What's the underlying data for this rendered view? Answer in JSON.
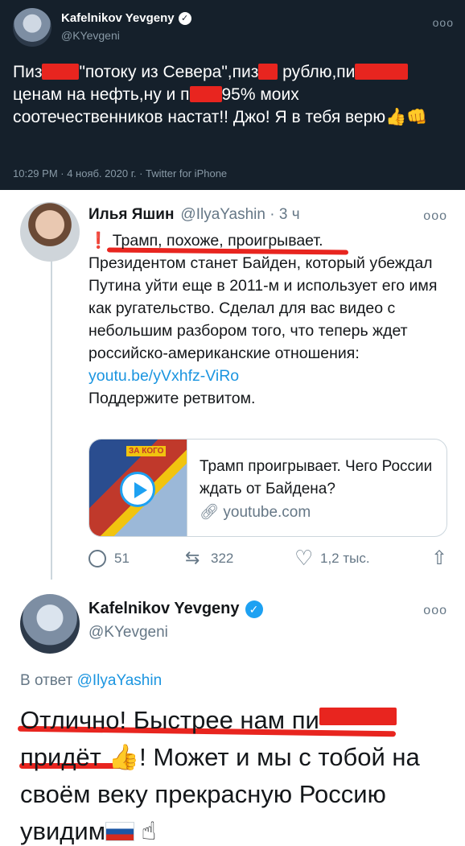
{
  "dark_tweet": {
    "name": "Kafelnikov Yevgeny",
    "handle": "@KYevgeni",
    "text_parts": [
      "Пиз",
      "\"потоку из Севера\",пиз",
      " рублю,пи",
      "ценам на нефть,ну и п",
      "95% моих соотечественников настат!! Джо! Я в тебя верю"
    ],
    "meta": "10:29 PM · 4 нояб. 2020 г. · Twitter for iPhone"
  },
  "yashin_tweet": {
    "name": "Илья Яшин",
    "handle": "@IlyaYashin · 3 ч",
    "alert": "❗",
    "line1": "Трамп, похоже, проигрывает.",
    "body": "Президентом станет Байден, который убеждал Путина уйти еще в 2011-м и использует его имя как ругательство. Сделал для вас видео с небольшим разбором того, что теперь ждет российско-американские отношения:",
    "link": "youtu.be/yVxhfz-ViRo",
    "closing": "Поддержите ретвитом.",
    "card": {
      "thumb_tag": "ЗА КОГО",
      "title": "Трамп проигрывает. Чего России ждать от Байдена?",
      "domain": "youtube.com"
    },
    "actions": {
      "replies": "51",
      "retweets": "322",
      "likes": "1,2 тыс."
    }
  },
  "reply_tweet": {
    "name": "Kafelnikov Yevgeny",
    "handle": "@KYevgeni",
    "reply_prefix": "В ответ",
    "reply_to": "@IlyaYashin",
    "text_a": "Отлично! Быстрее нам пи",
    "text_b": "придёт",
    "text_c": "! Может и мы с тобой на своём веку прекрасную Россию увидим"
  },
  "colors": {
    "dark_bg": "#15202b",
    "redaction": "#e8251f",
    "link": "#1b95e0",
    "verified": "#1da1f2"
  }
}
